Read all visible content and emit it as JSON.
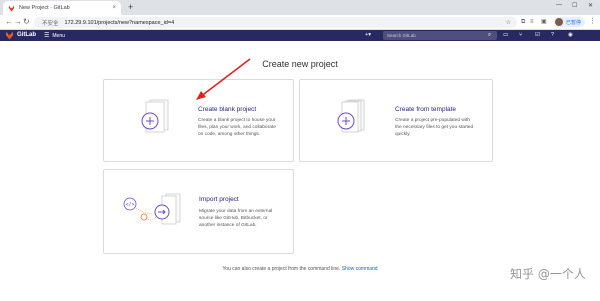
{
  "browser": {
    "tab_title": "New Project · GitLab",
    "tab_close": "×",
    "new_tab": "+",
    "security_label": "不安全",
    "url": "172.29.9.101/projects/new?namespace_id=4",
    "profile_label": "已暂停"
  },
  "gitlab": {
    "brand": "GitLab",
    "menu_label": "Menu",
    "plus_label": "+▾",
    "search_placeholder": "Search GitLab"
  },
  "page": {
    "title": "Create new project",
    "cards": [
      {
        "title": "Create blank project",
        "description": [
          "Create a blank project to house your",
          "files, plan your work, and collaborate",
          "on code, among other things."
        ]
      },
      {
        "title": "Create from template",
        "description": [
          "Create a project pre-populated with",
          "the necessary files to get you started",
          "quickly."
        ]
      },
      {
        "title": "Import project",
        "description": [
          "Migrate your data from an external",
          "source like GitHub, Bitbucket, or",
          "another instance of GitLab."
        ]
      }
    ],
    "footer_text": "You can also create a project from the command line.",
    "footer_link": "Show command"
  },
  "watermark": "知乎 @一个人",
  "colors": {
    "header_bg": "#292961",
    "link": "#1068bf",
    "annotation_arrow": "#e0221c",
    "card_border": "#dbdbdb"
  }
}
